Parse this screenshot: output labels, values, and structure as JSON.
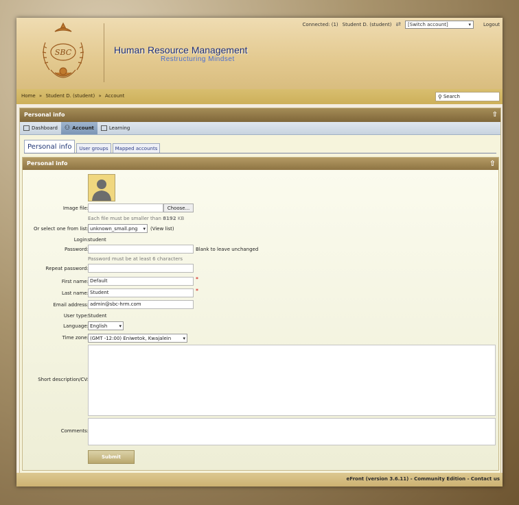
{
  "header": {
    "logo_text": "SBC",
    "app_title": "Human Resource Management",
    "app_subtitle": "Restructuring Mindset",
    "connected_label": "Connected: (1)",
    "user_label": "Student D. (student)",
    "switch_account": "[Switch account]",
    "logout": "Logout"
  },
  "breadcrumb": {
    "items": [
      "Home",
      "Student D. (student)",
      "Account"
    ],
    "separator": "»"
  },
  "search": {
    "placeholder": "Search"
  },
  "panel": {
    "title": "Personal info"
  },
  "nav": {
    "items": [
      "Dashboard",
      "Account",
      "Learning"
    ],
    "active": "Account"
  },
  "tabs": {
    "items": [
      "Personal info",
      "User groups",
      "Mapped accounts"
    ],
    "active": "Personal info"
  },
  "form": {
    "title": "Personal info",
    "image_file_label": "Image file:",
    "choose_button": "Choose...",
    "file_hint": "Each file must be smaller than",
    "file_hint_size": "8192",
    "file_hint_unit": "KB",
    "select_list_label": "Or select one from list:",
    "select_list_value": "unknown_small.png",
    "view_list": "(View list)",
    "login_label": "Login:",
    "login_value": "student",
    "password_label": "Password:",
    "password_note": "Blank to leave unchanged",
    "password_hint": "Password must be at least 6 characters",
    "repeat_password_label": "Repeat password:",
    "first_name_label": "First name:",
    "first_name_value": "Default",
    "last_name_label": "Last name:",
    "last_name_value": "Student",
    "email_label": "Email address:",
    "email_value": "admin@sbc-hrm.com",
    "user_type_label": "User type:",
    "user_type_value": "Student",
    "language_label": "Language:",
    "language_value": "English",
    "time_zone_label": "Time zone:",
    "time_zone_value": "(GMT -12:00) Eniwetok, Kwajalein",
    "short_desc_label": "Short description/CV:",
    "comments_label": "Comments:",
    "submit": "Submit",
    "required_mark": "*"
  },
  "footer": {
    "product": "eFront (version 3.6.11)",
    "edition": "Community Edition",
    "contact": "Contact us"
  },
  "colors": {
    "title": "#1d2e7a",
    "header_bg": "#e3c98f",
    "panel_head": "#8e7443"
  }
}
